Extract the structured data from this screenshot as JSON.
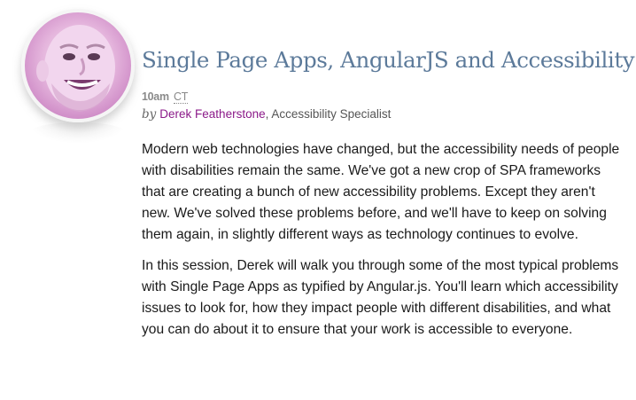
{
  "session": {
    "title": "Single Page Apps, AngularJS and Accessibility",
    "time": "10am",
    "timezone": "CT",
    "by_label": "by",
    "speaker_name": "Derek Featherstone",
    "speaker_role": ", Accessibility Specialist",
    "avatar_icon": "speaker-photo",
    "paragraphs": [
      "Modern web technologies have changed, but the accessibility needs of people with disabilities remain the same. We've got a new crop of SPA frameworks that are creating a bunch of new accessibility problems. Except they aren't new. We've solved these problems before, and we'll have to keep on solving them again, in slightly different ways as technology continues to evolve.",
      "In this session, Derek will walk you through some of the most typical problems with Single Page Apps as typified by Angular.js. You'll learn which accessibility issues to look for, how they impact people with different disabilities, and what you can do about it to ensure that your work is accessible to everyone."
    ]
  },
  "colors": {
    "title": "#5c7a9a",
    "speaker_link": "#8b1a89",
    "avatar_tint": "#e5b6dd"
  }
}
